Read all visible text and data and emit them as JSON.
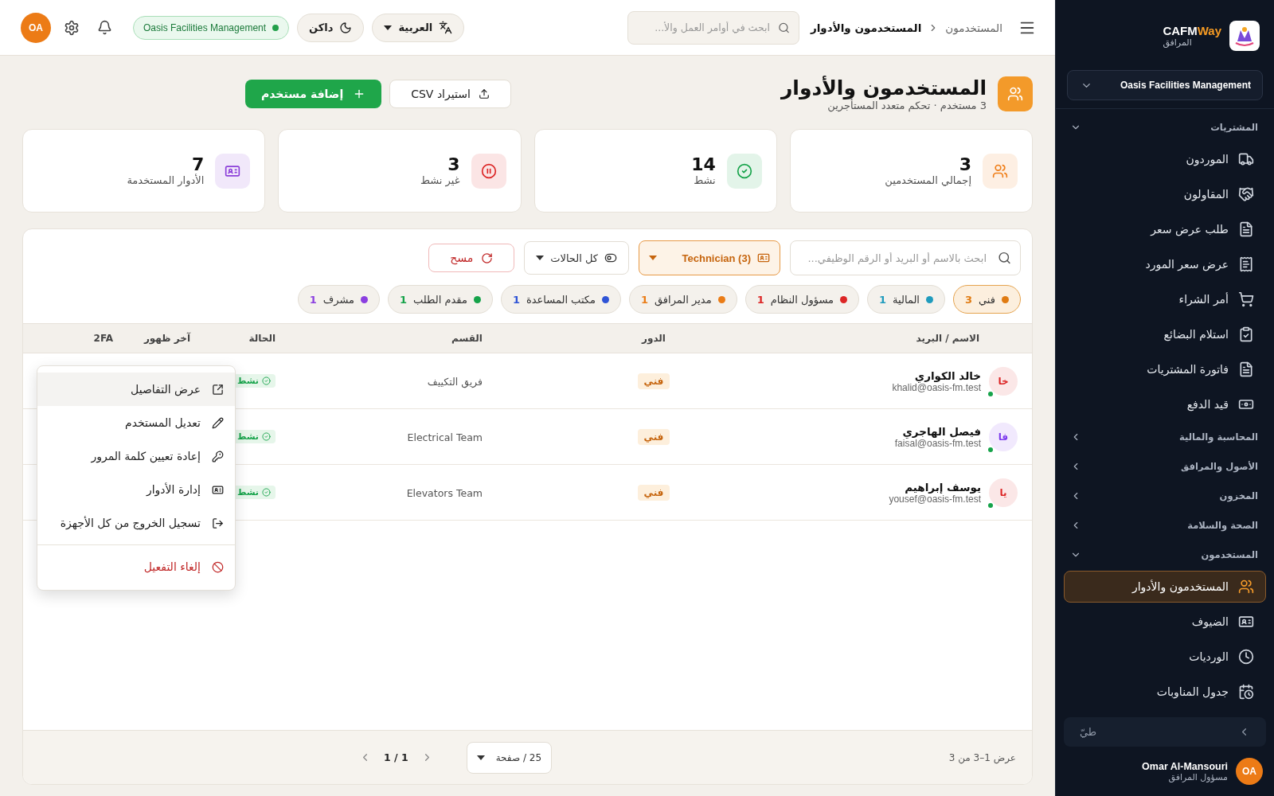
{
  "sidebar": {
    "brand": {
      "part_1": "CAFM",
      "part_2": "Way",
      "subtitle": "المرافق"
    },
    "org_select": "Oasis Facilities Management",
    "sections": [
      {
        "title": "المشتريات",
        "expanded": true,
        "items": [
          {
            "label": "الموردون",
            "selected": false
          },
          {
            "label": "المقاولون",
            "selected": false
          },
          {
            "label": "طلب عرض سعر",
            "selected": false
          },
          {
            "label": "عرض سعر المورد",
            "selected": false
          },
          {
            "label": "أمر الشراء",
            "selected": false
          },
          {
            "label": "استلام البضائع",
            "selected": false
          },
          {
            "label": "فاتورة المشتريات",
            "selected": false
          },
          {
            "label": "قيد الدفع",
            "selected": false
          }
        ]
      },
      {
        "title": "المحاسبة والمالية",
        "expanded": false
      },
      {
        "title": "الأصول والمرافق",
        "expanded": false
      },
      {
        "title": "المخزون",
        "expanded": false
      },
      {
        "title": "الصحة والسلامة",
        "expanded": false
      },
      {
        "title": "المستخدمون",
        "expanded": true,
        "items": [
          {
            "label": "المستخدمون والأدوار",
            "selected": true
          },
          {
            "label": "الضيوف",
            "selected": false
          },
          {
            "label": "الورديات",
            "selected": false
          },
          {
            "label": "جدول المناوبات",
            "selected": false
          }
        ]
      }
    ],
    "collapse_button": "طيّ",
    "user": {
      "initials": "OA",
      "name": "Omar Al-Mansouri",
      "role": "مسؤول المرافق"
    }
  },
  "topbar": {
    "breadcrumb": [
      "المستخدمون",
      "المستخدمون والأدوار"
    ],
    "search": {
      "placeholder": "ابحث في أوامر العمل والأ..."
    },
    "language": "العربية",
    "theme": "داكن",
    "org_badge": "Oasis Facilities Management",
    "avatar": "OA"
  },
  "header": {
    "title": "المستخدمون والأدوار",
    "subtitle": "3 مستخدم · تحكم متعدد المستأجرين",
    "import_button": "استيراد CSV",
    "add_button": "إضافة مستخدم"
  },
  "stats": [
    {
      "value": "3",
      "label": "إجمالي المستخدمين",
      "color": "#f07f1a"
    },
    {
      "value": "14",
      "label": "نشط",
      "color": "#16a34a"
    },
    {
      "value": "3",
      "label": "غير نشط",
      "color": "#dc2626"
    },
    {
      "value": "7",
      "label": "الأدوار المستخدمة",
      "color": "#8b3fd9"
    }
  ],
  "filters": {
    "search": {
      "placeholder": "ابحث بالاسم أو البريد أو الرقم الوظيفي..."
    },
    "role_select": "Technician (3)",
    "status_select": "كل الحالات",
    "clear_button": "مسح",
    "chips": [
      {
        "label": "فني",
        "count": "3",
        "color": "#e07b12",
        "selected": true
      },
      {
        "label": "المالية",
        "count": "1",
        "color": "#1f9bbd",
        "selected": false
      },
      {
        "label": "مسؤول النظام",
        "count": "1",
        "color": "#dc2626",
        "selected": false
      },
      {
        "label": "مدير المرافق",
        "count": "1",
        "color": "#ea7c16",
        "selected": false
      },
      {
        "label": "مكتب المساعدة",
        "count": "1",
        "color": "#2f54d6",
        "selected": false
      },
      {
        "label": "مقدم الطلب",
        "count": "1",
        "color": "#16a34a",
        "selected": false
      },
      {
        "label": "مشرف",
        "count": "1",
        "color": "#8b3fe0",
        "selected": false
      }
    ]
  },
  "table": {
    "columns": [
      "الاسم / البريد",
      "الدور",
      "القسم",
      "الحالة",
      "آخر ظهور",
      "2FA"
    ],
    "rows": [
      {
        "initials": "خا",
        "color": "#dc2626",
        "online": true,
        "name": "خالد الكواري",
        "email": "khalid@oasis-fm.test",
        "role": "فني",
        "department": "فريق التكييف",
        "status": "نشط"
      },
      {
        "initials": "فا",
        "color": "#7c3aed",
        "online": true,
        "name": "فيصل الهاجري",
        "email": "faisal@oasis-fm.test",
        "role": "فني",
        "department": "Electrical Team",
        "status": "نشط"
      },
      {
        "initials": "يا",
        "color": "#dc2626",
        "online": true,
        "name": "يوسف إبراهيم",
        "email": "yousef@oasis-fm.test",
        "role": "فني",
        "department": "Elevators Team",
        "status": "نشط"
      }
    ]
  },
  "row_menu": [
    {
      "label": "عرض التفاصيل",
      "kind": "normal",
      "selected": true
    },
    {
      "label": "تعديل المستخدم",
      "kind": "normal",
      "selected": false
    },
    {
      "label": "إعادة تعيين كلمة المرور",
      "kind": "normal",
      "selected": false
    },
    {
      "label": "إدارة الأدوار",
      "kind": "normal",
      "selected": false
    },
    {
      "label": "تسجيل الخروج من كل الأجهزة",
      "kind": "normal",
      "selected": false
    },
    {
      "label": "إلغاء التفعيل",
      "kind": "danger",
      "selected": false
    }
  ],
  "footer": {
    "summary": "عرض 1–3 من 3",
    "page_size": "25 / صفحة",
    "page": "1 / 1"
  }
}
